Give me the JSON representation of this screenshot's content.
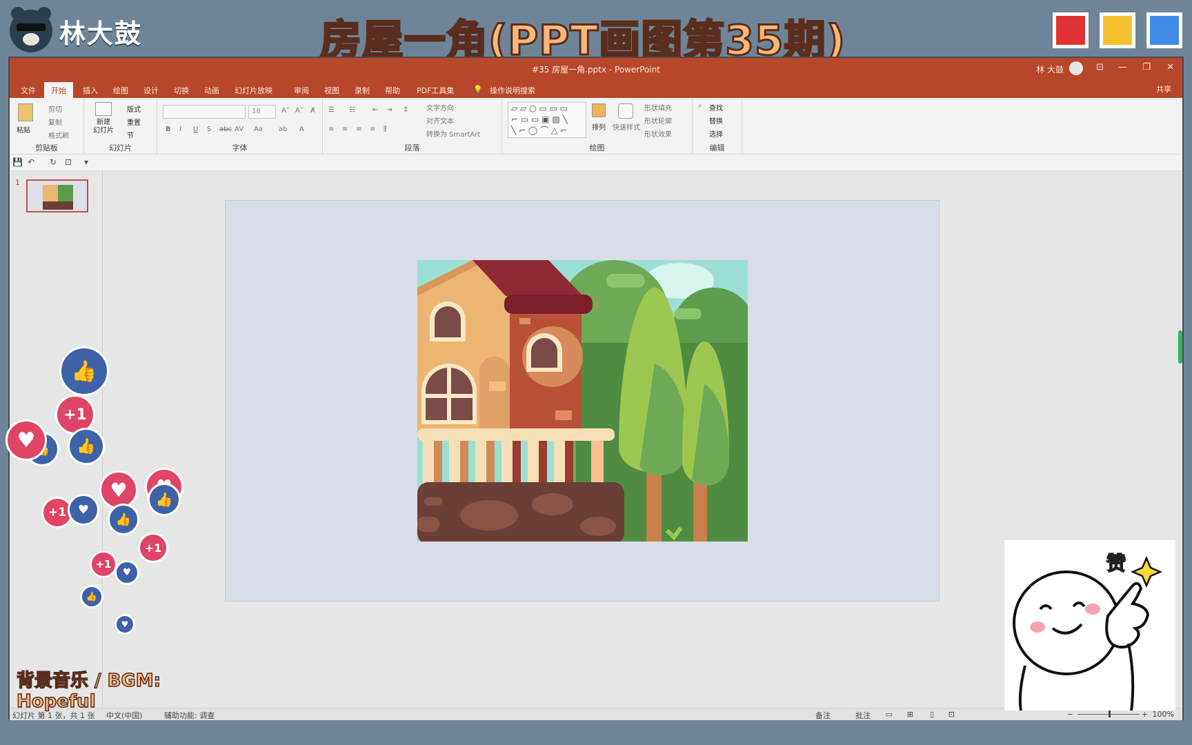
{
  "brand": {
    "name": "林大鼓"
  },
  "banner": {
    "title": "房屋一角(PPT画图第35期)"
  },
  "swatches": [
    "#e03233",
    "#f5c02e",
    "#4089e6"
  ],
  "window": {
    "title": "#35 房屋一角.pptx - PowerPoint",
    "user": "林 大鼓",
    "share": "共享",
    "tabs": [
      "文件",
      "开始",
      "插入",
      "绘图",
      "设计",
      "切换",
      "动画",
      "幻灯片放映",
      "审阅",
      "视图",
      "录制",
      "帮助",
      "PDF工具集",
      "操作说明搜索"
    ],
    "active_tab": "开始"
  },
  "ribbon": {
    "clipboard": {
      "paste": "粘贴",
      "cut": "剪切",
      "copy": "复制",
      "format_painter": "格式刷",
      "label": "剪贴板"
    },
    "slides": {
      "new_slide": "新建\n幻灯片",
      "layout": "版式",
      "reset": "重置",
      "section": "节",
      "label": "幻灯片"
    },
    "font": {
      "size": "18",
      "label": "字体"
    },
    "paragraph": {
      "text_direction": "文字方向",
      "align_text": "对齐文本",
      "smartart": "转换为 SmartArt",
      "label": "段落"
    },
    "drawing": {
      "arrange": "排列",
      "quick_styles": "快速样式",
      "fill": "形状填充",
      "outline": "形状轮廓",
      "effects": "形状效果",
      "label": "绘图"
    },
    "editing": {
      "find": "查找",
      "replace": "替换",
      "select": "选择",
      "label": "编辑"
    }
  },
  "thumbnail": {
    "number": "1"
  },
  "statusbar": {
    "slide_info": "幻灯片 第 1 张，共 1 张",
    "language": "中文(中国)",
    "accessibility": "辅助功能: 调查",
    "notes": "备注",
    "comments": "批注",
    "zoom": "100%"
  },
  "reactions": {
    "plus_one": "+1",
    "heart": "♥"
  },
  "bgm": "背景音乐 / BGM: Hopeful",
  "sticker": {
    "text": "赞"
  }
}
